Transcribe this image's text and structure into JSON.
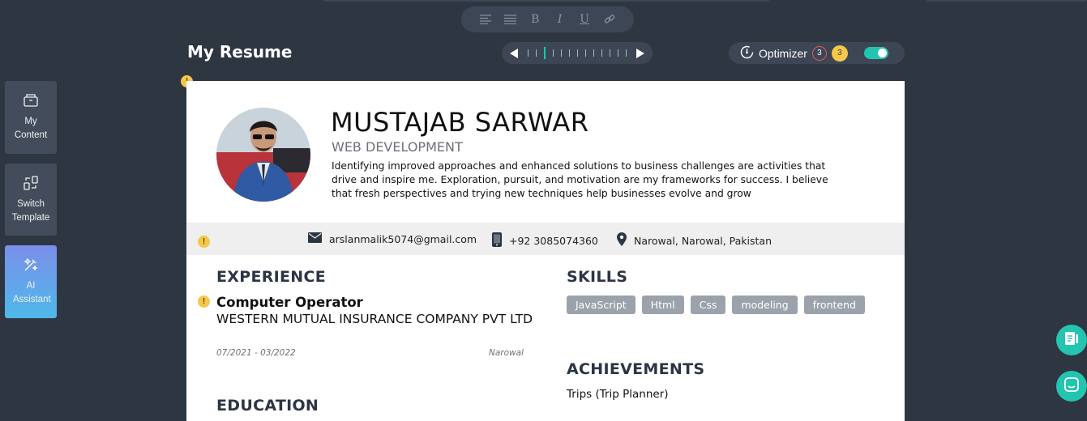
{
  "toolbar": {
    "format_buttons": [
      {
        "icon": "align-left-icon",
        "glyph": "≡"
      },
      {
        "icon": "align-justify-icon",
        "glyph": "☰"
      },
      {
        "icon": "bold-icon",
        "glyph": "B"
      },
      {
        "icon": "italic-icon",
        "glyph": "I"
      },
      {
        "icon": "underline-icon",
        "glyph": "U"
      },
      {
        "icon": "link-icon",
        "glyph": "⛓"
      }
    ]
  },
  "page_title": "My Resume",
  "optimizer": {
    "label": "Optimizer",
    "issues_count": "3",
    "warnings_count": "3",
    "enabled": true
  },
  "sidebar": {
    "items": [
      {
        "label": "My Content",
        "icon": "folder-icon"
      },
      {
        "label": "Switch Template",
        "icon": "switch-template-icon"
      },
      {
        "label": "AI Assistant",
        "icon": "ai-assistant-icon"
      }
    ]
  },
  "resume": {
    "name": "MUSTAJAB SARWAR",
    "role": "WEB DEVELOPMENT",
    "summary": "Identifying improved approaches and enhanced solutions to business challenges are activities that drive and inspire me. Exploration, pursuit, and motivation are my frameworks for success. I believe that fresh perspectives and trying new techniques help businesses evolve and grow",
    "contact": {
      "email": "arslanmalik5074@gmail.com",
      "phone": "+92 3085074360",
      "location": "Narowal, Narowal, Pakistan"
    },
    "experience": {
      "heading": "EXPERIENCE",
      "jobs": [
        {
          "title": "Computer Operator",
          "company": "WESTERN MUTUAL INSURANCE COMPANY PVT LTD",
          "dates": "07/2021 - 03/2022",
          "location": "Narowal"
        }
      ]
    },
    "education": {
      "heading": "EDUCATION"
    },
    "skills": {
      "heading": "SKILLS",
      "items": [
        "JavaScript",
        "Html",
        "Css",
        "modeling",
        "frontend"
      ]
    },
    "achievements": {
      "heading": "ACHIEVEMENTS",
      "items": [
        "Trips (Trip Planner)"
      ]
    }
  },
  "colors": {
    "background": "#2e3641",
    "panel": "#3d4654",
    "accent": "#25c4b0",
    "warning": "#f5c84a",
    "heading": "#2c3544"
  }
}
